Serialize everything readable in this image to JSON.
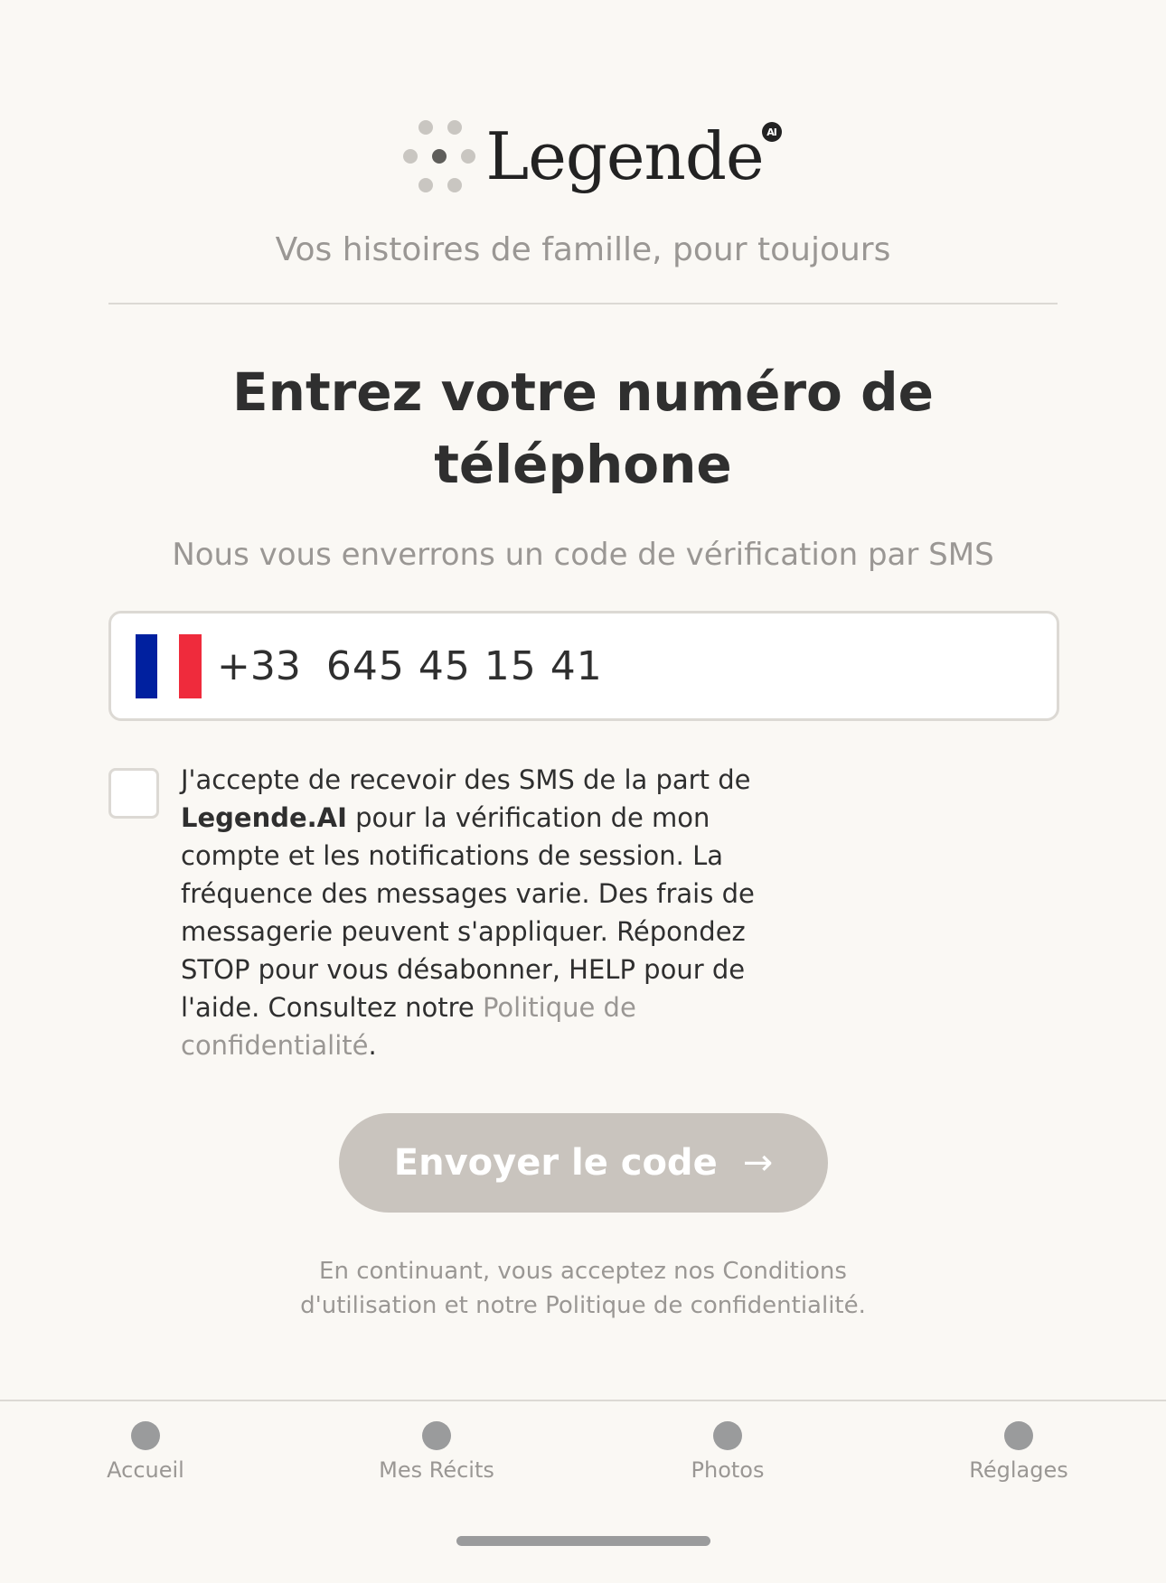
{
  "brand": {
    "name": "Legende",
    "badge": "AI",
    "tagline": "Vos histoires de famille, pour toujours"
  },
  "screen": {
    "title": "Entrez votre numéro de téléphone",
    "subtitle": "Nous vous enverrons un code de vérification par SMS"
  },
  "phone": {
    "country_flag": "france-flag",
    "dial_code": "+33",
    "value": "645 45 15 41"
  },
  "consent": {
    "checked": false,
    "text_1": "J'accepte de recevoir des SMS de la part de ",
    "brand": "Legende.AI",
    "text_2": " pour la vérification de mon compte et les notifications de session. La fréquence des messages varie. Des frais de messagerie peuvent s'appliquer. Répondez STOP pour vous désabonner, HELP pour de l'aide. Consultez notre ",
    "privacy_link": "Politique de confidentialité",
    "text_3": "."
  },
  "send_button": {
    "label": "Envoyer le code",
    "arrow": "→",
    "enabled": false
  },
  "legal": {
    "line_1": "En continuant, vous acceptez nos Conditions",
    "line_2": "d'utilisation et notre Politique de confidentialité."
  },
  "tabs": [
    {
      "label": "Accueil",
      "icon": "dot-icon"
    },
    {
      "label": "Mes Récits",
      "icon": "dot-icon"
    },
    {
      "label": "Photos",
      "icon": "dot-icon"
    },
    {
      "label": "Réglages",
      "icon": "dot-icon"
    }
  ],
  "colors": {
    "background": "#faf8f4",
    "muted_text": "#9a9794",
    "button_disabled": "#c9c4be"
  }
}
